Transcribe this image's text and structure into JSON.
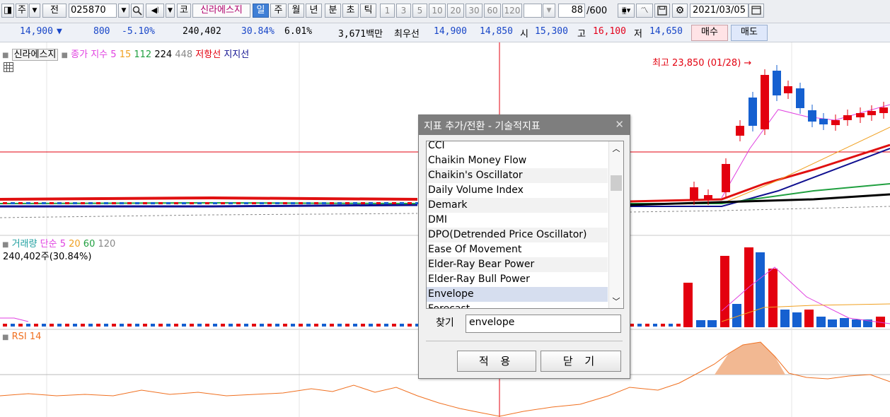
{
  "toolbar": {
    "market_button": "주",
    "prev_label": "전",
    "stock_code": "025870",
    "market_tag": "코",
    "stock_name": "신라에스지",
    "periods": [
      "일",
      "주",
      "월",
      "년",
      "분",
      "초",
      "틱"
    ],
    "selected_period": "일",
    "period_nums": [
      "1",
      "3",
      "5",
      "10",
      "20",
      "30",
      "60",
      "120"
    ],
    "count_value": "88",
    "count_total": "/600",
    "date": "2021/03/05"
  },
  "quote": {
    "price": "14,900",
    "change_arrow": "▼",
    "change": "800",
    "change_pct": "-5.10%",
    "volume": "240,402",
    "turnover_pct": "30.84%",
    "extra_pct": "6.01%",
    "amount": "3,671백만",
    "best_label": "최우선",
    "best_sell": "14,900",
    "best_buy": "14,850",
    "open_label": "시",
    "open": "15,300",
    "high_label": "고",
    "high": "16,100",
    "low_label": "저",
    "low": "14,650",
    "buy_btn": "매수",
    "sell_btn": "매도"
  },
  "price_legend": {
    "name": "신라에스지",
    "close_label": "종가 지수",
    "ma": [
      "5",
      "15",
      "112",
      "224",
      "448"
    ],
    "resistance": "저항선",
    "support": "지지선"
  },
  "high_annotation": "최고 23,850 (01/28) →",
  "volume_legend": {
    "label": "거래량",
    "simple": "단순",
    "ma": [
      "5",
      "20",
      "60",
      "120"
    ],
    "value": "240,402주(30.84%)"
  },
  "rsi_legend": {
    "label": "RSI 14"
  },
  "dialog": {
    "title": "지표 추가/전환 - 기술적지표",
    "items": [
      "CCI",
      "Chaikin Money Flow",
      "Chaikin's Oscillator",
      "Daily Volume Index",
      "Demark",
      "DMI",
      "DPO(Detrended Price Oscillator)",
      "Ease Of Movement",
      "Elder-Ray Bear Power",
      "Elder-Ray Bull Power",
      "Envelope",
      "Forecast..."
    ],
    "selected_item": "Envelope",
    "search_label": "찾기",
    "search_value": "envelope",
    "apply_button": "적 용",
    "close_button": "닫 기"
  },
  "colors": {
    "up": "#e3000f",
    "down": "#1560d0",
    "ma5": "#e040e0",
    "ma15": "#f0a020",
    "ma112": "#e01010",
    "ma224": "#101090",
    "ma448": "#000000",
    "ma_green": "#20a040",
    "rsi": "#f07020",
    "rsi_fill": "#f2b892"
  }
}
